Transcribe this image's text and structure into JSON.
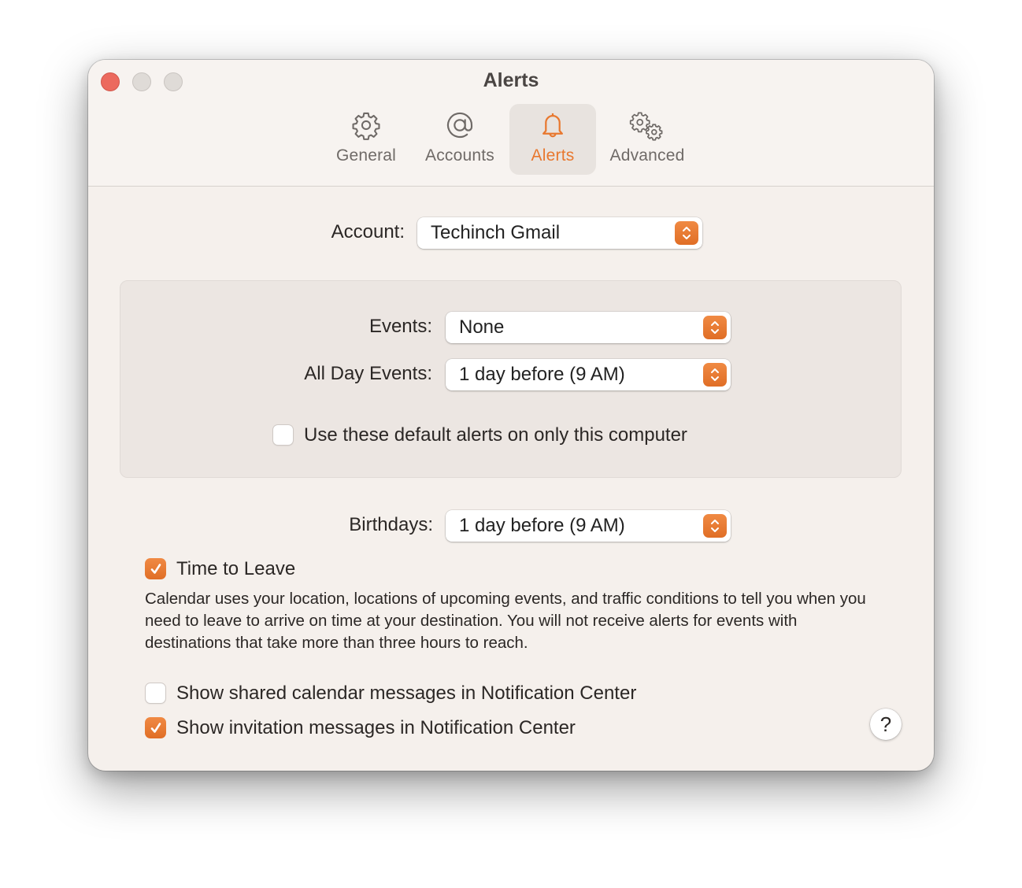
{
  "window": {
    "title": "Alerts",
    "traffic_lights": [
      "close",
      "minimize",
      "zoom"
    ]
  },
  "tabs": [
    {
      "label": "General",
      "icon": "gear-icon",
      "active": false
    },
    {
      "label": "Accounts",
      "icon": "at-sign-icon",
      "active": false
    },
    {
      "label": "Alerts",
      "icon": "bell-icon",
      "active": true
    },
    {
      "label": "Advanced",
      "icon": "gears-icon",
      "active": false
    }
  ],
  "account": {
    "label": "Account:",
    "value": "Techinch Gmail"
  },
  "default_alerts": {
    "events": {
      "label": "Events:",
      "value": "None"
    },
    "all_day_events": {
      "label": "All Day Events:",
      "value": "1 day before (9 AM)"
    },
    "local_only": {
      "label": "Use these default alerts on only this computer",
      "checked": false
    }
  },
  "birthdays": {
    "label": "Birthdays:",
    "value": "1 day before (9 AM)"
  },
  "time_to_leave": {
    "label": "Time to Leave",
    "checked": true,
    "description": "Calendar uses your location, locations of upcoming events, and traffic conditions to tell you when you need to leave to arrive on time at your destination. You will not receive alerts for events with destinations that take more than three hours to reach."
  },
  "shared_messages": {
    "label": "Show shared calendar messages in Notification Center",
    "checked": false
  },
  "invitation_messages": {
    "label": "Show invitation messages in Notification Center",
    "checked": true
  },
  "help": {
    "label": "?"
  },
  "colors": {
    "accent": "#e8782f",
    "close": "#ec6a5e",
    "window_bg": "#f5f0ec",
    "group_bg": "#ece6e2"
  }
}
